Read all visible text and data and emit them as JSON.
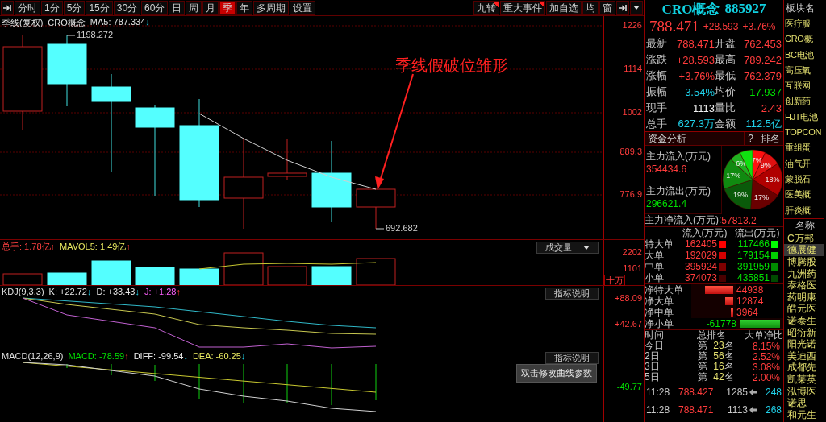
{
  "toolbar": {
    "tabs": [
      {
        "label": "分时",
        "selected": false
      },
      {
        "label": "1分",
        "selected": false
      },
      {
        "label": "5分",
        "selected": false
      },
      {
        "label": "15分",
        "selected": false
      },
      {
        "label": "30分",
        "selected": false
      },
      {
        "label": "60分",
        "selected": false
      },
      {
        "label": "日",
        "selected": false
      },
      {
        "label": "周",
        "selected": false
      },
      {
        "label": "月",
        "selected": false
      },
      {
        "label": "季",
        "selected": true
      },
      {
        "label": "年",
        "selected": false
      },
      {
        "label": "多周期",
        "selected": false
      },
      {
        "label": "设置",
        "selected": false
      }
    ],
    "right_buttons": [
      {
        "label": "九转",
        "flagged": true
      },
      {
        "label": "重大事件",
        "flagged": true
      },
      {
        "label": "加自选",
        "flagged": false
      },
      {
        "label": "均",
        "flagged": false
      },
      {
        "label": "窗",
        "flagged": false
      }
    ]
  },
  "price_chart": {
    "period": "季线(复权)",
    "name": "CRO概念",
    "ma_label": "MA5: 787.334",
    "ma_arrow": "↓",
    "ma_rising": false,
    "axis": [
      "1226",
      "1114",
      "1002",
      "889.3",
      "776.9"
    ],
    "high_label": "1198.272",
    "low_label": "692.682",
    "annotation": "季线假破位雏形"
  },
  "volume": {
    "legend": [
      {
        "kind": "total",
        "text": "总手: 1.78亿",
        "arrow": "↑",
        "rising": true
      },
      {
        "kind": "ma",
        "text": "MAVOL5: 1.49亿",
        "arrow": "↑",
        "rising": true
      }
    ],
    "selector": "成交量",
    "axis": [
      "2202",
      "1101"
    ],
    "unit": "十万"
  },
  "kdj": {
    "legend": [
      {
        "kind": "title",
        "text": "KDJ(9,3,3)"
      },
      {
        "kind": "k",
        "text": "K: +22.72",
        "arrow": "↓",
        "rising": false
      },
      {
        "kind": "d",
        "text": "D: +33.43",
        "arrow": "↓",
        "rising": false
      },
      {
        "kind": "j",
        "text": "J: +1.28",
        "arrow": "↑",
        "rising": true
      }
    ],
    "button": "指标说明",
    "axis": [
      "+88.09",
      "+42.67"
    ]
  },
  "macd": {
    "legend": [
      {
        "kind": "title",
        "text": "MACD(12,26,9)"
      },
      {
        "kind": "macd",
        "text": "MACD: -78.59",
        "arrow": "↑",
        "rising": true
      },
      {
        "kind": "diff",
        "text": "DIFF: -99.54",
        "arrow": "↓",
        "rising": false
      },
      {
        "kind": "dea",
        "text": "DEA: -60.25",
        "arrow": "↓",
        "rising": false
      }
    ],
    "button": "指标说明",
    "axis": [
      "-49.77"
    ],
    "tooltip": "双击修改曲线参数"
  },
  "quote": {
    "name": "CRO概念",
    "code": "885927",
    "price": "788.471",
    "change": "+28.593",
    "change_pct": "+3.76%",
    "fields": [
      {
        "label": "最新",
        "value": "788.471",
        "kind": "up"
      },
      {
        "label": "开盘",
        "value": "762.453",
        "kind": "up"
      },
      {
        "label": "涨跌",
        "value": "+28.593",
        "kind": "up"
      },
      {
        "label": "最高",
        "value": "789.242",
        "kind": "up"
      },
      {
        "label": "涨幅",
        "value": "+3.76%",
        "kind": "up"
      },
      {
        "label": "最低",
        "value": "762.379",
        "kind": "up"
      },
      {
        "label": "振幅",
        "value": "3.54%",
        "kind": "info"
      },
      {
        "label": "均价",
        "value": "17.937",
        "kind": "down"
      },
      {
        "label": "现手",
        "value": "1113",
        "kind": "plain"
      },
      {
        "label": "量比",
        "value": "2.43",
        "kind": "up"
      },
      {
        "label": "总手",
        "value": "627.3万",
        "kind": "info"
      },
      {
        "label": "金额",
        "value": "112.5亿",
        "kind": "info"
      }
    ]
  },
  "fund": {
    "title": "资金分析",
    "help": "?",
    "rank_button": "排名",
    "inflow_label": "主力流入(万元)",
    "inflow": "354434.6",
    "outflow_label": "主力流出(万元)",
    "outflow": "296621.4",
    "chart_data": {
      "type": "pie",
      "values": [
        7,
        9,
        18,
        17,
        19,
        17,
        6,
        7
      ],
      "value_labels": [
        "7%",
        "9%",
        "18%",
        "17%",
        "19%",
        "17%",
        "6%",
        null
      ]
    },
    "net_label": "主力净流入(万元):",
    "net": "57813.2",
    "flow_headers": [
      "流入(万元)",
      "流出(万元)"
    ],
    "flows": [
      {
        "label": "特大单",
        "inflow": {
          "value": "162405",
          "color": "#ff0000"
        },
        "outflow": {
          "value": "117466",
          "color": "#00ff00"
        }
      },
      {
        "label": "大单",
        "inflow": {
          "value": "192029",
          "color": "#d40000"
        },
        "outflow": {
          "value": "179154",
          "color": "#00d000"
        }
      },
      {
        "label": "中单",
        "inflow": {
          "value": "395924",
          "color": "#800000"
        },
        "outflow": {
          "value": "391959",
          "color": "#008a00"
        }
      },
      {
        "label": "小单",
        "inflow": {
          "value": "374073",
          "color": "#4a0000"
        },
        "outflow": {
          "value": "435851",
          "color": "#004a00"
        }
      }
    ],
    "net_bars": [
      {
        "label": "净特大单",
        "value": "44938",
        "kind": "inflow",
        "level": 0.73
      },
      {
        "label": "净大单",
        "value": "12874",
        "kind": "inflow",
        "level": 0.21
      },
      {
        "label": "净中单",
        "value": "3964",
        "kind": "inflow",
        "level": 0.07
      },
      {
        "label": "净小单",
        "value": "-61778",
        "kind": "outflow",
        "level": 1
      }
    ],
    "rank_headers": [
      "时间",
      "总排名",
      "大单净比"
    ],
    "ranks": [
      {
        "period": "今日",
        "prefix": "第",
        "rank": "23",
        "suffix": "名",
        "ratio": "8.15%"
      },
      {
        "period": "2日",
        "prefix": "第",
        "rank": "56",
        "suffix": "名",
        "ratio": "2.52%"
      },
      {
        "period": "3日",
        "prefix": "第",
        "rank": "16",
        "suffix": "名",
        "ratio": "3.08%"
      },
      {
        "period": "5日",
        "prefix": "第",
        "rank": "42",
        "suffix": "名",
        "ratio": "2.00%"
      }
    ]
  },
  "ticks": [
    {
      "time": "11:28",
      "price": "788.427",
      "volume": "1285",
      "count": "248"
    },
    {
      "time": "11:28",
      "price": "788.471",
      "volume": "1113",
      "count": "268"
    }
  ],
  "sector_list": {
    "header": "板块名",
    "items": [
      "医疗服",
      "CRO概",
      "BC电池",
      "高压氧",
      "互联网",
      "创新药",
      "HJT电池",
      "TOPCON",
      "重组蛋",
      "油气开",
      "蒙脱石",
      "医美概",
      "肝炎概"
    ]
  },
  "stock_list": {
    "header": "名称",
    "items": [
      {
        "name": "C万邦",
        "selected": false
      },
      {
        "name": "德展健",
        "selected": true
      },
      {
        "name": "博腾股",
        "selected": false
      },
      {
        "name": "九洲药",
        "selected": false
      },
      {
        "name": "泰格医",
        "selected": false
      },
      {
        "name": "药明康",
        "selected": false
      },
      {
        "name": "皓元医",
        "selected": false
      },
      {
        "name": "诺泰生",
        "selected": false
      },
      {
        "name": "昭衍新",
        "selected": false
      },
      {
        "name": "阳光诺",
        "selected": false
      },
      {
        "name": "美迪西",
        "selected": false
      },
      {
        "name": "成都先",
        "selected": false
      },
      {
        "name": "凯莱英",
        "selected": false
      },
      {
        "name": "泓博医",
        "selected": false
      },
      {
        "name": "诺思",
        "selected": false
      },
      {
        "name": "和元生",
        "selected": false
      }
    ]
  }
}
